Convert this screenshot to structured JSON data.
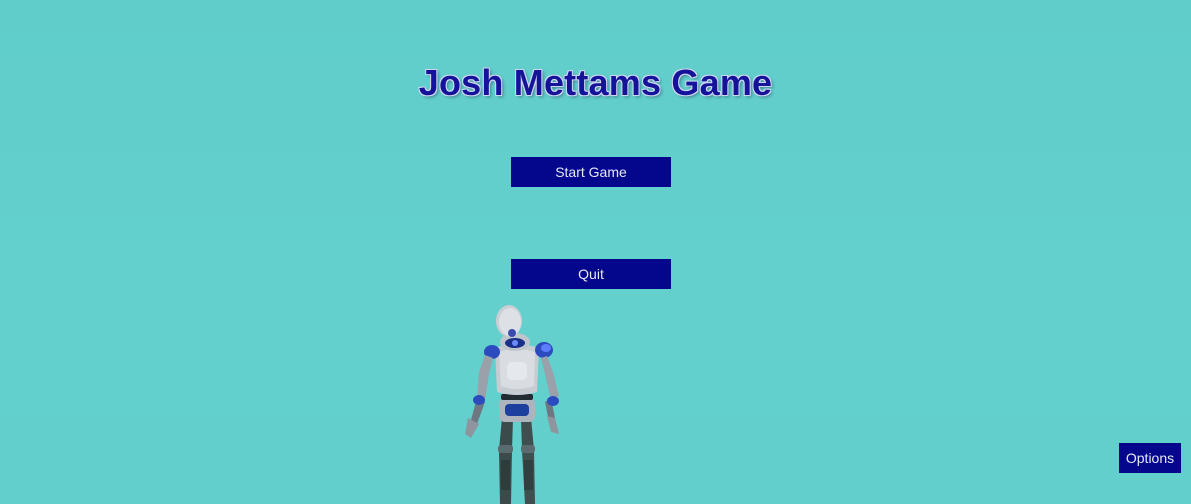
{
  "scene": {
    "background_color": "#62cfcc",
    "character": "robot-character"
  },
  "main_menu": {
    "title": "Josh Mettams Game",
    "start_label": "Start Game",
    "quit_label": "Quit",
    "options_label": "Options",
    "button_color": "#04068c",
    "title_color": "#15139a"
  }
}
